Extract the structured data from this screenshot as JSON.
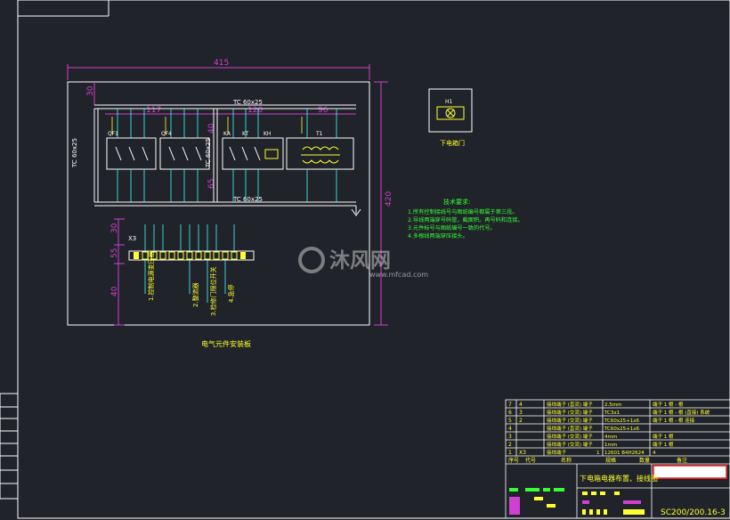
{
  "drawing": {
    "dimensions": {
      "overall_width": "415",
      "overall_height": "420",
      "top_margin": "30",
      "section_left": "117",
      "section_mid": "120",
      "section_right": "96",
      "v_40": "40",
      "v_65": "65",
      "v_30": "30",
      "v_55": "55",
      "v_40b": "40"
    },
    "duct_label_top": "TC 60x25",
    "duct_label_bottom": "TC 60x25",
    "duct_label_left": "TC 60x25",
    "duct_label_mid": "TC 60x25",
    "device_labels": [
      "QF1",
      "QF4",
      "KA",
      "KT",
      "KH",
      "T1"
    ],
    "terminal_strip_label": "X3",
    "panel_title": "电气元件安装板",
    "lamp_symbol_label": "H1",
    "lamp_caption": "下电箱门",
    "tech_requirements": {
      "title": "技术要求:",
      "lines": [
        "1.所有控制接线号与图纸编号都属于第三段。",
        "2.导线两端穿号码管，截面积。再号码和连接。",
        "3.元件标号与图纸编号一致的代号。",
        "4.多根线两端穿压接头。"
      ]
    },
    "bottom_annotations": [
      "1.控制电源变压器",
      "2.整流器",
      "3.检修门限位开关",
      "4.急停"
    ]
  },
  "watermark": {
    "brand_cn": "沐风网",
    "url": "www.mfcad.com"
  },
  "title_block": {
    "rows": [
      {
        "no": "7",
        "code": "4",
        "name": "接线端子 (直流) 端子",
        "spec": "2.5mm",
        "qty": "",
        "note": "端子 1 根 - 根"
      },
      {
        "no": "6",
        "code": "3",
        "name": "接线端子 (交流) 端子",
        "spec": "TC3x1",
        "qty": "",
        "note": "端子 1 根 - 根 (直接) 系统"
      },
      {
        "no": "5",
        "code": "2",
        "name": "接线端子 (交流) 端子",
        "spec": "TC60x25+1x6",
        "qty": "",
        "note": "端子 1 根 - 根 连接"
      },
      {
        "no": "4",
        "code": "",
        "name": "接线端子 (直流) 端子",
        "spec": "TC60x25+1x6",
        "qty": "",
        "note": ""
      },
      {
        "no": "3",
        "code": "",
        "name": "接线端子 (交流) 端子",
        "spec": "4mm",
        "qty": "",
        "note": "端子 1 根"
      },
      {
        "no": "2",
        "code": "",
        "name": "接线端子 (交流) 端子",
        "spec": "1mm",
        "qty": "",
        "note": "端子 1 根"
      },
      {
        "no": "1",
        "code": "X3",
        "name": "接线端子",
        "spec": "12601 B4H2624",
        "qty": "1",
        "note": "4"
      }
    ],
    "header": [
      "序号",
      "代号",
      "名称",
      "规格",
      "数量",
      "备注"
    ],
    "drawing_title": "下电箱电器布置、接线图",
    "drawing_number": "SC200/200.16-3"
  },
  "colors": {
    "background": "#202329",
    "outline": "#ffffff",
    "dimension": "#d040d0",
    "wire": "#40ffff",
    "component": "#ffff30",
    "note": "#35ff35",
    "table": "#ffff30"
  }
}
